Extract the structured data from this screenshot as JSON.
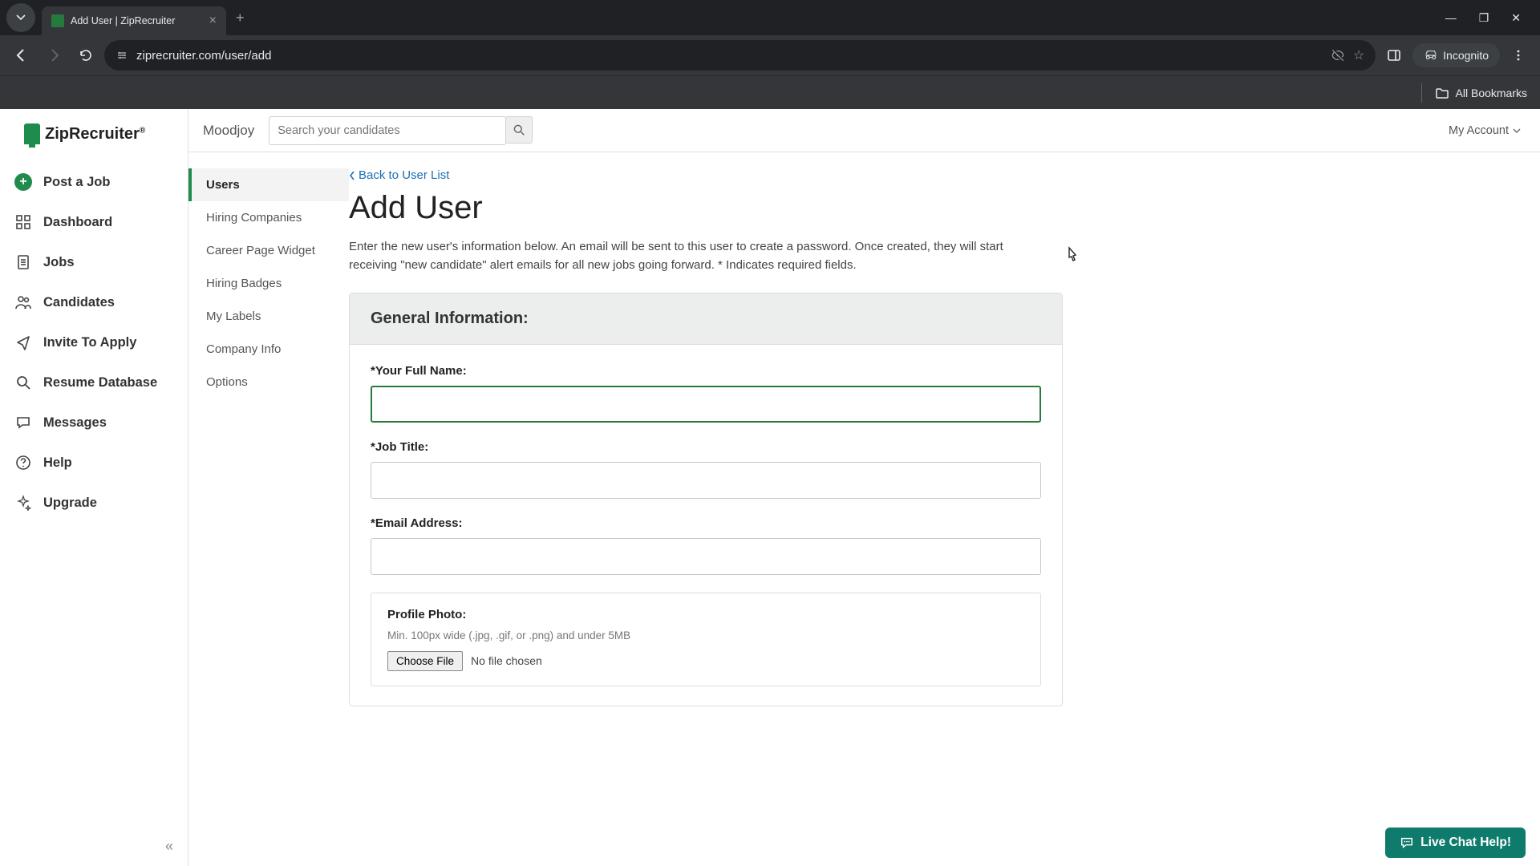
{
  "browser": {
    "tab_title": "Add User | ZipRecruiter",
    "url": "ziprecruiter.com/user/add",
    "incognito_label": "Incognito",
    "all_bookmarks": "All Bookmarks"
  },
  "logo": {
    "text": "ZipRecruiter"
  },
  "sidebar": {
    "items": [
      {
        "label": "Post a Job",
        "icon": "plus-circle"
      },
      {
        "label": "Dashboard",
        "icon": "grid"
      },
      {
        "label": "Jobs",
        "icon": "document"
      },
      {
        "label": "Candidates",
        "icon": "people"
      },
      {
        "label": "Invite To Apply",
        "icon": "send"
      },
      {
        "label": "Resume Database",
        "icon": "search"
      },
      {
        "label": "Messages",
        "icon": "chat"
      },
      {
        "label": "Help",
        "icon": "help"
      },
      {
        "label": "Upgrade",
        "icon": "sparkle"
      }
    ]
  },
  "header": {
    "org": "Moodjoy",
    "search_placeholder": "Search your candidates",
    "my_account": "My Account"
  },
  "subnav": {
    "items": [
      {
        "label": "Users",
        "active": true
      },
      {
        "label": "Hiring Companies"
      },
      {
        "label": "Career Page Widget"
      },
      {
        "label": "Hiring Badges"
      },
      {
        "label": "My Labels"
      },
      {
        "label": "Company Info"
      },
      {
        "label": "Options"
      }
    ]
  },
  "content": {
    "back_link": "Back to User List",
    "title": "Add User",
    "description": "Enter the new user's information below. An email will be sent to this user to create a password. Once created, they will start receiving \"new candidate\" alert emails for all new jobs going forward. * Indicates required fields.",
    "panel_header": "General Information:",
    "fields": {
      "full_name_label": "*Your Full Name:",
      "job_title_label": "*Job Title:",
      "email_label": "*Email Address:",
      "photo_label": "Profile Photo:",
      "photo_hint": "Min. 100px wide (.jpg, .gif, or .png) and under 5MB",
      "choose_file": "Choose File",
      "no_file": "No file chosen"
    }
  },
  "chat": {
    "label": "Live Chat Help!"
  }
}
